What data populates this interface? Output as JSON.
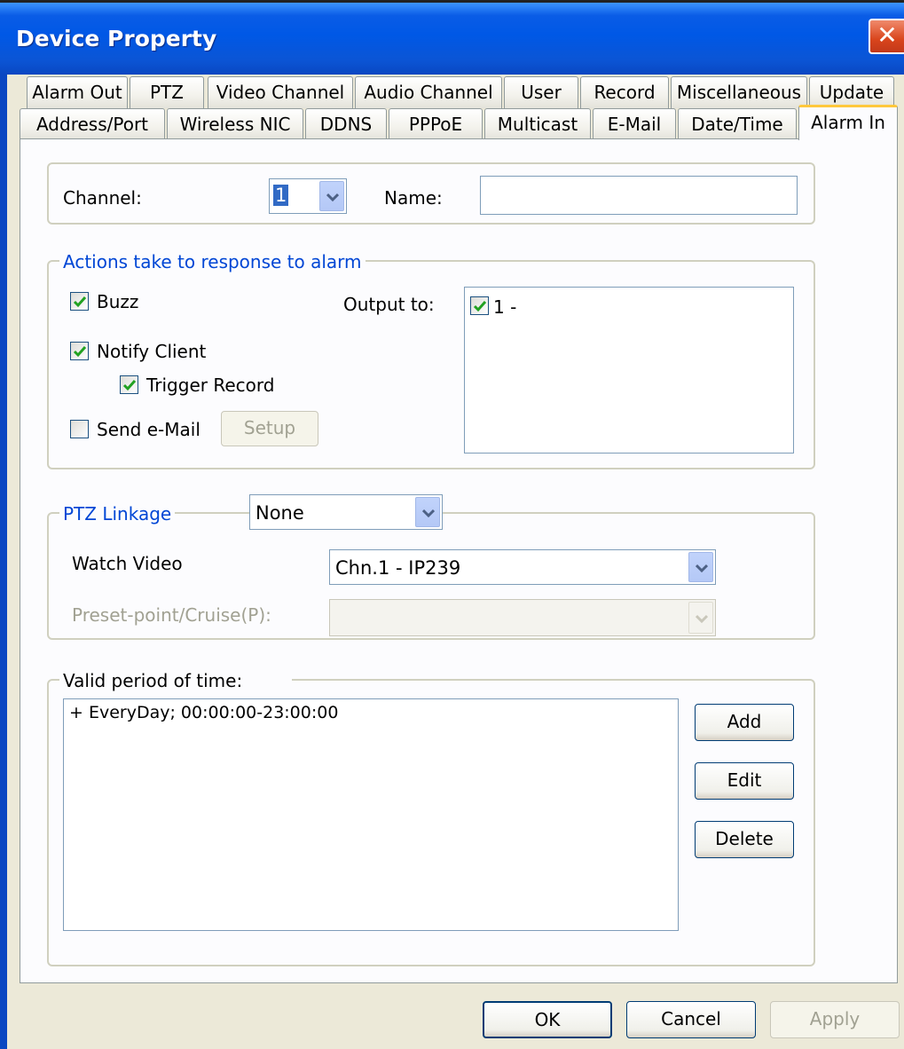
{
  "window": {
    "title": "Device Property",
    "close_glyph": "✕"
  },
  "tabs_row1": [
    "Alarm Out",
    "PTZ",
    "Video Channel",
    "Audio Channel",
    "User",
    "Record",
    "Miscellaneous",
    "Update"
  ],
  "tabs_row2": [
    "Address/Port",
    "Wireless NIC",
    "DDNS",
    "PPPoE",
    "Multicast",
    "E-Mail",
    "Date/Time",
    "Alarm In"
  ],
  "active_tab": "Alarm In",
  "channel": {
    "label": "Channel:",
    "value": "1",
    "name_label": "Name:",
    "name_value": ""
  },
  "actions": {
    "legend": "Actions take to response to alarm",
    "buzz": {
      "label": "Buzz",
      "checked": true
    },
    "notify_client": {
      "label": "Notify Client",
      "checked": true
    },
    "trigger_record": {
      "label": "Trigger Record",
      "checked": true
    },
    "send_email": {
      "label": "Send e-Mail",
      "checked": false
    },
    "setup_button": "Setup",
    "output_label": "Output to:",
    "output_items": [
      {
        "label": "1 -",
        "checked": true
      }
    ]
  },
  "ptz": {
    "legend": "PTZ Linkage",
    "linkage_value": "None",
    "watch_video_label": "Watch Video",
    "watch_video_value": "Chn.1 - IP239",
    "preset_label": "Preset-point/Cruise(P):",
    "preset_value": ""
  },
  "period": {
    "legend": "Valid period of time:",
    "items": [
      "+ EveryDay; 00:00:00-23:00:00"
    ],
    "add_button": "Add",
    "edit_button": "Edit",
    "delete_button": "Delete"
  },
  "footer": {
    "ok": "OK",
    "cancel": "Cancel",
    "apply": "Apply"
  },
  "colors": {
    "title_bar": "#0058e6",
    "group_legend": "#0046d5",
    "dialog_bg": "#ece9d8",
    "active_tab_accent": "#ffc83c"
  }
}
